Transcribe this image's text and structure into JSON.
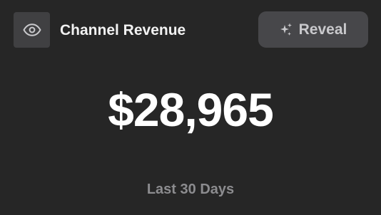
{
  "header": {
    "visibility_icon": "eye-icon",
    "title": "Channel Revenue",
    "reveal_button": {
      "icon": "sparkle-icon",
      "label": "Reveal"
    }
  },
  "metric": {
    "value": "$28,965",
    "period": "Last 30 Days"
  },
  "colors": {
    "background": "#262626",
    "icon_button_bg": "#404042",
    "reveal_button_bg": "#47474a",
    "primary_text": "#ffffff",
    "secondary_text": "#8c8c8f"
  }
}
